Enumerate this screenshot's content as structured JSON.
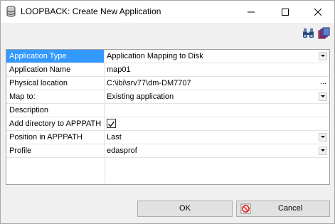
{
  "window": {
    "title": "LOOPBACK: Create New Application"
  },
  "icons": {
    "app": "database-icon",
    "minimize": "minimize-icon",
    "maximize": "maximize-icon",
    "close": "close-icon",
    "find": "binoculars-icon",
    "copy": "copy-pages-icon",
    "cancel": "cancel-circle-icon"
  },
  "properties": [
    {
      "label": "Application Type",
      "value": "Application Mapping to Disk",
      "editor": "dropdown",
      "selected": true
    },
    {
      "label": "Application Name",
      "value": "map01",
      "editor": "text"
    },
    {
      "label": "Physical location",
      "value": "C:\\ibi\\srv77\\dm-DM7707",
      "editor": "browse",
      "browse_label": "..."
    },
    {
      "label": "Map to:",
      "value": "Existing application",
      "editor": "dropdown"
    },
    {
      "label": "Description",
      "value": "",
      "editor": "text"
    },
    {
      "label": "Add directory to APPPATH",
      "value": "",
      "editor": "checkbox",
      "checked": true
    },
    {
      "label": "Position in APPPATH",
      "value": "Last",
      "editor": "dropdown"
    },
    {
      "label": "Profile",
      "value": "edasprof",
      "editor": "dropdown"
    }
  ],
  "buttons": {
    "ok": "OK",
    "cancel": "Cancel"
  },
  "colors": {
    "selection": "#3399ff",
    "cancel_icon": "#e03030"
  }
}
